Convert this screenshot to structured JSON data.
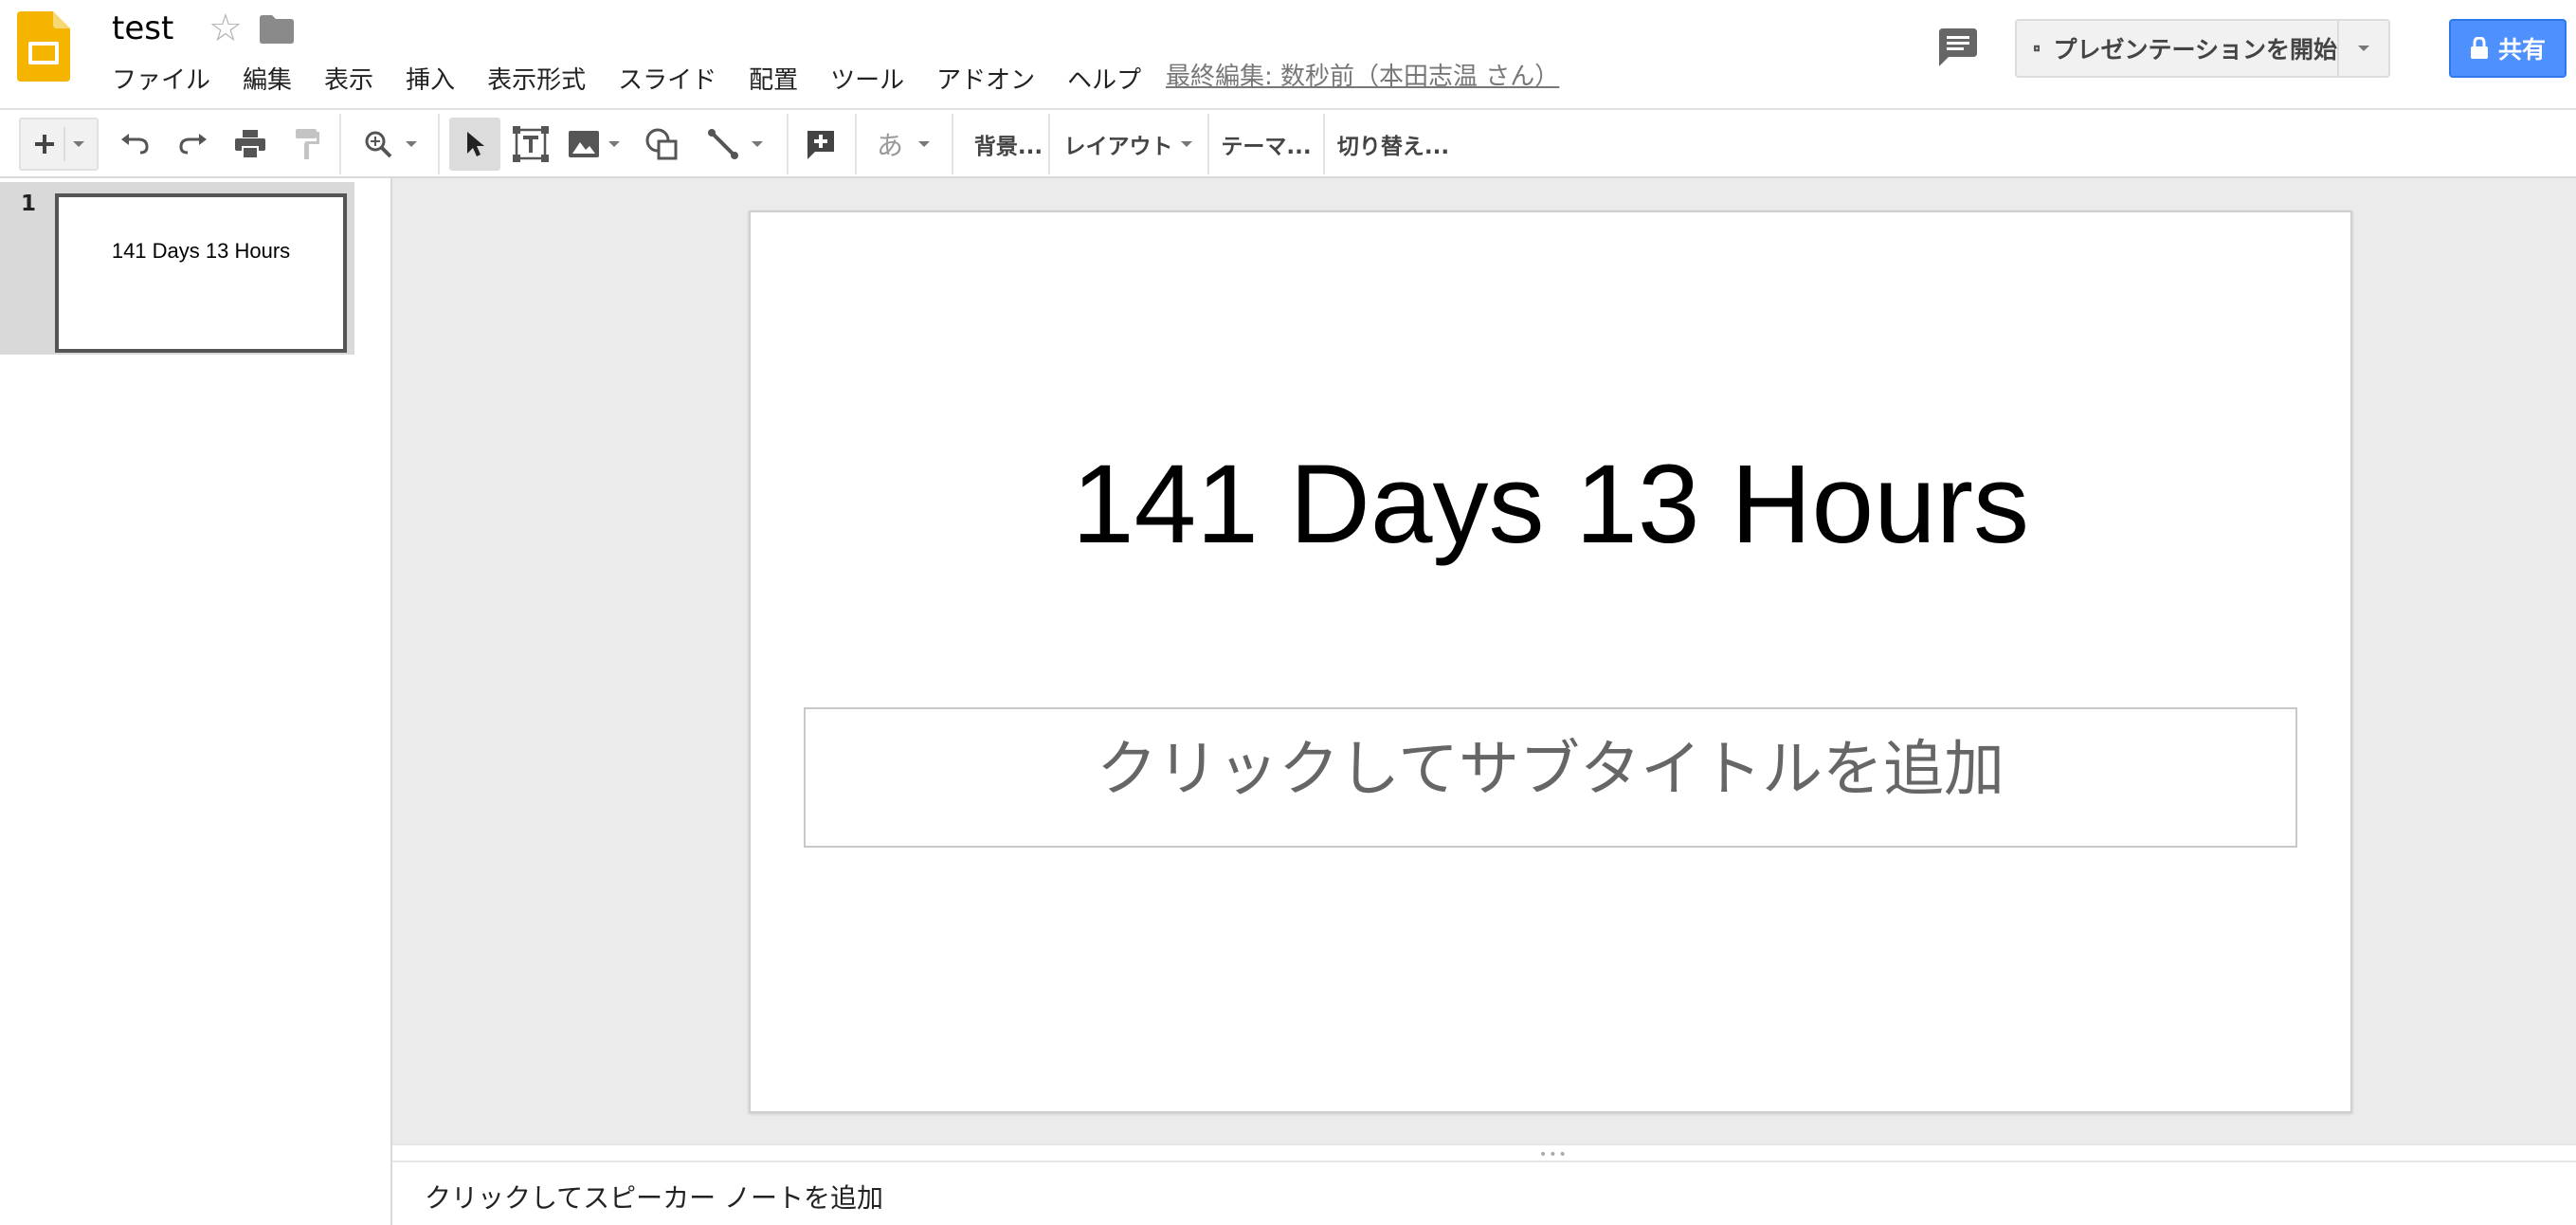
{
  "app": {
    "doc_title": "test",
    "brand_color": "#f4b400",
    "accent_color": "#4d90fe"
  },
  "menu": [
    "ファイル",
    "編集",
    "表示",
    "挿入",
    "表示形式",
    "スライド",
    "配置",
    "ツール",
    "アドオン",
    "ヘルプ"
  ],
  "last_edit": "最終編集: 数秒前（本田志温 さん）",
  "actions": {
    "present_label": "プレゼンテーションを開始",
    "share_label": "共有"
  },
  "toolbar": {
    "text_style_label": "あ",
    "background_label": "背景...",
    "layout_label": "レイアウト",
    "theme_label": "テーマ...",
    "transition_label": "切り替え..."
  },
  "filmstrip": {
    "slides": [
      {
        "number": "1",
        "title": "141 Days 13 Hours"
      }
    ]
  },
  "slide": {
    "title": "141 Days 13 Hours",
    "subtitle_placeholder": "クリックしてサブタイトルを追加"
  },
  "notes": {
    "placeholder": "クリックしてスピーカー ノートを追加"
  }
}
